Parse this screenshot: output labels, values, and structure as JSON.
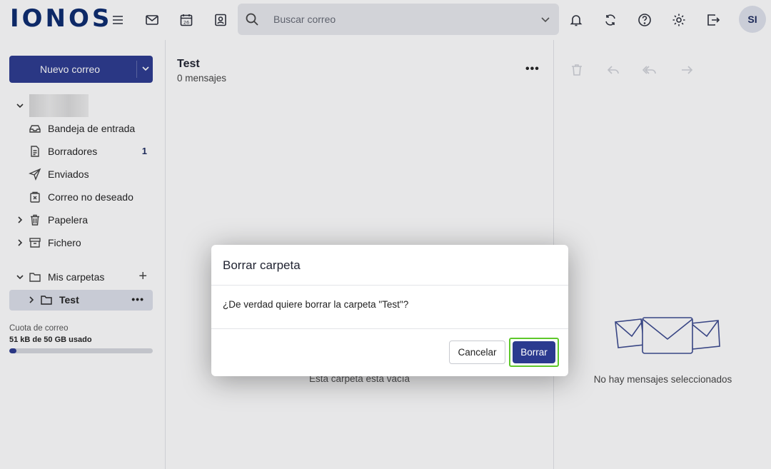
{
  "brand": {
    "logo_text": "IONOS",
    "accent": "#2b3a8f",
    "highlight": "#5ec82a"
  },
  "topbar": {
    "search_placeholder": "Buscar correo",
    "avatar_initials": "SI",
    "icons": [
      "menu-icon",
      "mail-icon",
      "calendar-icon",
      "contacts-icon",
      "search-icon",
      "bell-icon",
      "sync-icon",
      "help-icon",
      "settings-icon",
      "logout-icon"
    ],
    "calendar_day": "26"
  },
  "sidebar": {
    "new_mail_label": "Nuevo correo",
    "folders": [
      {
        "label": "Bandeja de entrada",
        "icon": "inbox-icon"
      },
      {
        "label": "Borradores",
        "icon": "drafts-icon",
        "count": "1"
      },
      {
        "label": "Enviados",
        "icon": "sent-icon"
      },
      {
        "label": "Correo no deseado",
        "icon": "spam-icon"
      },
      {
        "label": "Papelera",
        "icon": "trash-icon"
      },
      {
        "label": "Fichero",
        "icon": "archive-icon"
      }
    ],
    "my_folders_label": "Mis carpetas",
    "custom_folder_label": "Test",
    "quota_label": "Cuota de correo",
    "quota_value": "51 kB de 50 GB usado",
    "quota_fraction": 0.05
  },
  "list": {
    "folder_title": "Test",
    "message_count": "0 mensajes",
    "empty_text": "Esta carpeta está vacía"
  },
  "reading": {
    "no_selection_text": "No hay mensajes seleccionados"
  },
  "dialog": {
    "title": "Borrar carpeta",
    "message": "¿De verdad quiere borrar la carpeta \"Test\"?",
    "cancel_label": "Cancelar",
    "confirm_label": "Borrar"
  }
}
